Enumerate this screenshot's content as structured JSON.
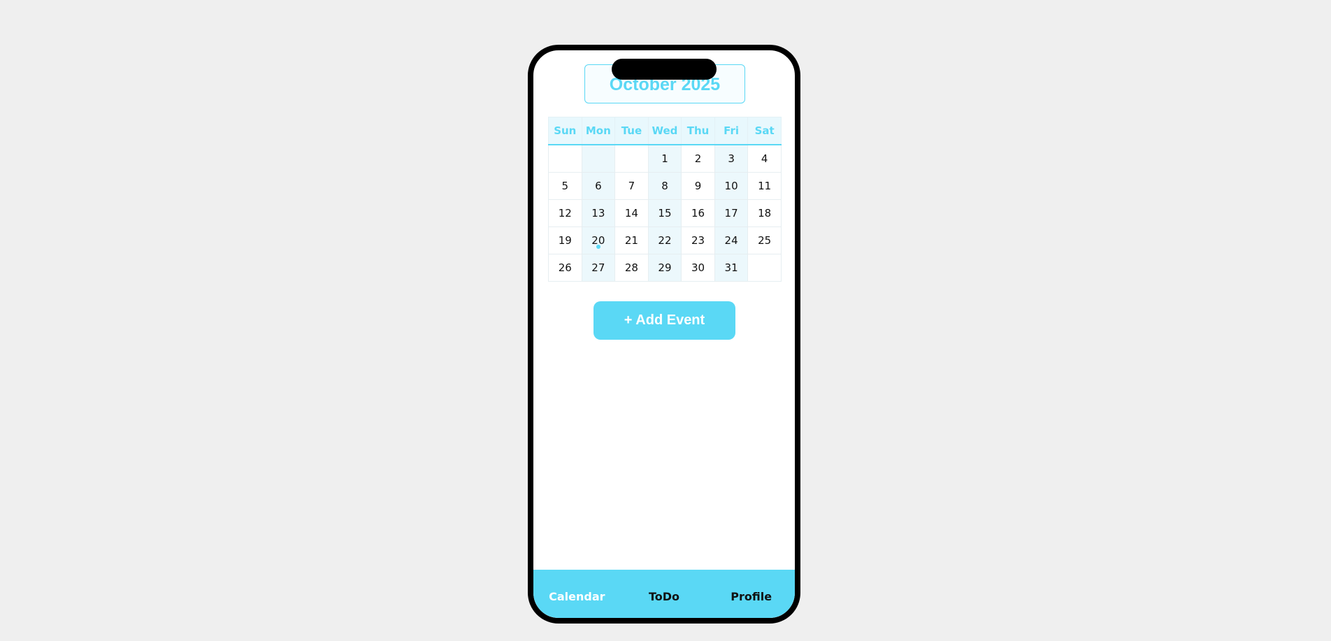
{
  "calendar": {
    "month_title": "October 2025",
    "weekdays": [
      "Sun",
      "Mon",
      "Tue",
      "Wed",
      "Thu",
      "Fri",
      "Sat"
    ],
    "weeks": [
      [
        "",
        "",
        "",
        "1",
        "2",
        "3",
        "4"
      ],
      [
        "5",
        "6",
        "7",
        "8",
        "9",
        "10",
        "11"
      ],
      [
        "12",
        "13",
        "14",
        "15",
        "16",
        "17",
        "18"
      ],
      [
        "19",
        "20",
        "21",
        "22",
        "23",
        "24",
        "25"
      ],
      [
        "26",
        "27",
        "28",
        "29",
        "30",
        "31",
        ""
      ]
    ],
    "highlighted_weekdays": [
      "Mon",
      "Wed",
      "Fri"
    ],
    "event_marker_day": "20"
  },
  "actions": {
    "add_event_label": "+ Add Event"
  },
  "nav": {
    "items": [
      {
        "label": "Calendar",
        "active": true
      },
      {
        "label": "ToDo",
        "active": false
      },
      {
        "label": "Profile",
        "active": false
      }
    ]
  },
  "colors": {
    "accent": "#5ad8f5",
    "header_bg": "#e8f8fd",
    "shaded_column": "#ecf8fc",
    "page_bg": "#efefef"
  }
}
